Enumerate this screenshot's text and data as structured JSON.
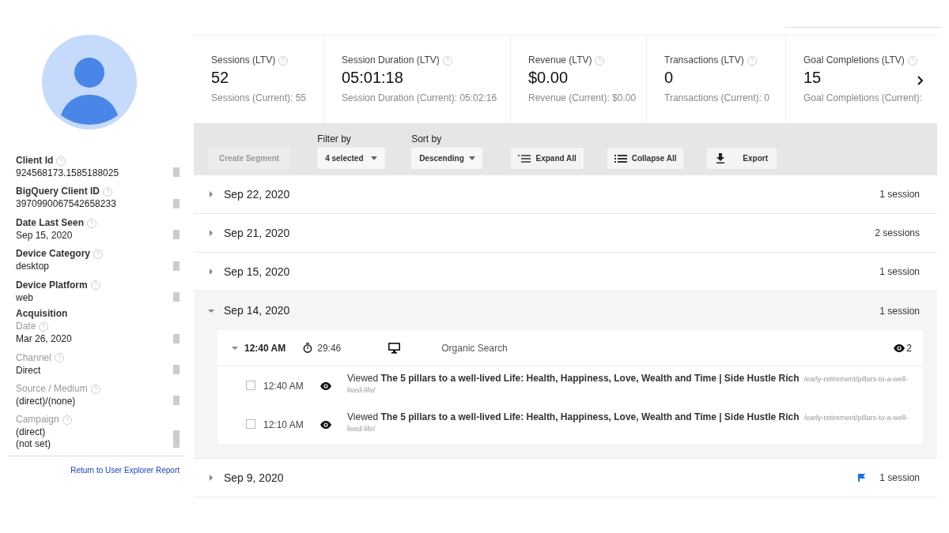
{
  "profile": {
    "fields": [
      {
        "label": "Client Id",
        "value": [
          "924568173.1585188025"
        ],
        "kind": "primary"
      },
      {
        "label": "BigQuery Client ID",
        "value": [
          "3970990067542658233"
        ],
        "kind": "primary"
      },
      {
        "label": "Date Last Seen",
        "value": [
          "Sep 15, 2020"
        ],
        "kind": "primary"
      },
      {
        "label": "Device Category",
        "value": [
          "desktop"
        ],
        "kind": "primary"
      },
      {
        "label": "Device Platform",
        "value": [
          "web"
        ],
        "kind": "primary"
      },
      {
        "heading": "Acquisition",
        "label": "Date",
        "value": [
          "Mar 26, 2020"
        ],
        "kind": "secondary"
      },
      {
        "label": "Channel",
        "value": [
          "Direct"
        ],
        "kind": "secondary"
      },
      {
        "label": "Source / Medium",
        "value": [
          "(direct)/(none)"
        ],
        "kind": "secondary"
      },
      {
        "label": "Campaign",
        "value": [
          "(direct)",
          "(not set)"
        ],
        "kind": "secondary"
      }
    ],
    "return_link": "Return to User Explorer Report"
  },
  "metrics": [
    {
      "label": "Sessions (LTV)",
      "value": "52",
      "current": "Sessions (Current): 55"
    },
    {
      "label": "Session Duration (LTV)",
      "value": "05:01:18",
      "current": "Session Duration (Current): 05:02:16"
    },
    {
      "label": "Revenue (LTV)",
      "value": "$0.00",
      "current": "Revenue (Current): $0.00"
    },
    {
      "label": "Transactions (LTV)",
      "value": "0",
      "current": "Transactions (Current): 0"
    },
    {
      "label": "Goal Completions (LTV)",
      "value": "15",
      "current": "Goal Completions (Current):"
    }
  ],
  "toolbar": {
    "create_segment": {
      "label": "Create Segment",
      "disabled": true
    },
    "filter": {
      "label": "Filter by",
      "value": "4 selected"
    },
    "sort": {
      "label": "Sort by",
      "value": "Descending"
    },
    "buttons": [
      {
        "label": "Expand All",
        "kind": "expand"
      },
      {
        "label": "Collapse All",
        "kind": "collapse"
      },
      {
        "label": "Export",
        "kind": "export"
      }
    ]
  },
  "days": [
    {
      "date": "Sep 22, 2020",
      "sessions": "1 session",
      "expanded": false,
      "flagged": false
    },
    {
      "date": "Sep 21, 2020",
      "sessions": "2 sessions",
      "expanded": false,
      "flagged": false
    },
    {
      "date": "Sep 15, 2020",
      "sessions": "1 session",
      "expanded": false,
      "flagged": false
    },
    {
      "date": "Sep 14, 2020",
      "sessions": "1 session",
      "expanded": true,
      "flagged": false,
      "session": {
        "time": "12:40 AM",
        "duration": "29:46",
        "channel": "Organic Search",
        "pageviews": "2",
        "expanded": true,
        "hits": [
          {
            "checked": false,
            "time": "12:40 AM",
            "text": "Viewed **The 5 pillars to a well-lived Life: Health, Happiness, Love, Wealth and Time | Side Hustle Rich**",
            "path": "/early-retirement/pillars-to-a-well-lived-life/"
          },
          {
            "checked": false,
            "time": "12:10 AM",
            "text": "Viewed **The 5 pillars to a well-lived Life: Health, Happiness, Love, Wealth and Time | Side Hustle Rich**",
            "path": "/early-retirement/pillars-to-a-well-lived-life/"
          }
        ]
      }
    },
    {
      "date": "Sep 9, 2020",
      "sessions": "1 session",
      "expanded": false,
      "flagged": true
    }
  ]
}
